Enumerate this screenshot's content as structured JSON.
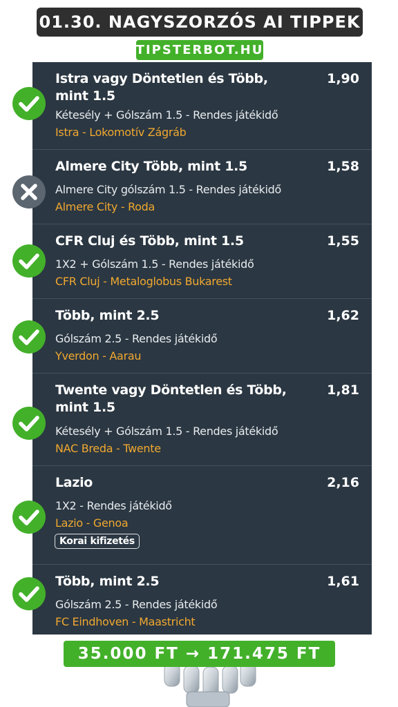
{
  "header": {
    "title": "01.30. NAGYSZORZÓS AI TIPPEK",
    "site": "TIPSTERBOT.HU"
  },
  "colors": {
    "panel": "#2b3742",
    "accent_green": "#43b02a",
    "match_orange": "#f0a830",
    "won": "#43b02a",
    "lost": "#5b6670"
  },
  "bets": [
    {
      "title": "Istra vagy Döntetlen és Több, mint 1.5",
      "odds": "1,90",
      "market": "Kétesély + Gólszám 1.5 - Rendes játékidő",
      "match": "Istra - Lokomotív Zágráb",
      "status": "won",
      "status_icon": "check-circle-icon"
    },
    {
      "title": "Almere City Több, mint 1.5",
      "odds": "1,58",
      "market": "Almere City gólszám 1.5 - Rendes játékidő",
      "match": "Almere City - Roda",
      "status": "lost",
      "status_icon": "x-circle-icon"
    },
    {
      "title": "CFR Cluj és Több, mint 1.5",
      "odds": "1,55",
      "market": "1X2 + Gólszám 1.5 - Rendes játékidő",
      "match": "CFR Cluj - Metaloglobus Bukarest",
      "status": "won",
      "status_icon": "check-circle-icon"
    },
    {
      "title": "Több, mint 2.5",
      "odds": "1,62",
      "market": "Gólszám 2.5 - Rendes játékidő",
      "match": "Yverdon - Aarau",
      "status": "won",
      "status_icon": "check-circle-icon"
    },
    {
      "title": "Twente vagy Döntetlen és Több, mint 1.5",
      "odds": "1,81",
      "market": "Kétesély + Gólszám 1.5 - Rendes játékidő",
      "match": "NAC Breda - Twente",
      "status": "won",
      "status_icon": "check-circle-icon"
    },
    {
      "title": "Lazio",
      "odds": "2,16",
      "market": "1X2 - Rendes játékidő",
      "match": "Lazio - Genoa",
      "badge": "Korai kifizetés",
      "status": "won",
      "status_icon": "check-circle-icon"
    },
    {
      "title": "Több, mint 2.5",
      "odds": "1,61",
      "market": "Gólszám 2.5 - Rendes játékidő",
      "match": "FC Eindhoven - Maastricht",
      "status": "won",
      "status_icon": "check-circle-icon"
    }
  ],
  "footer": {
    "total": "35.000 FT → 171.475 FT"
  }
}
